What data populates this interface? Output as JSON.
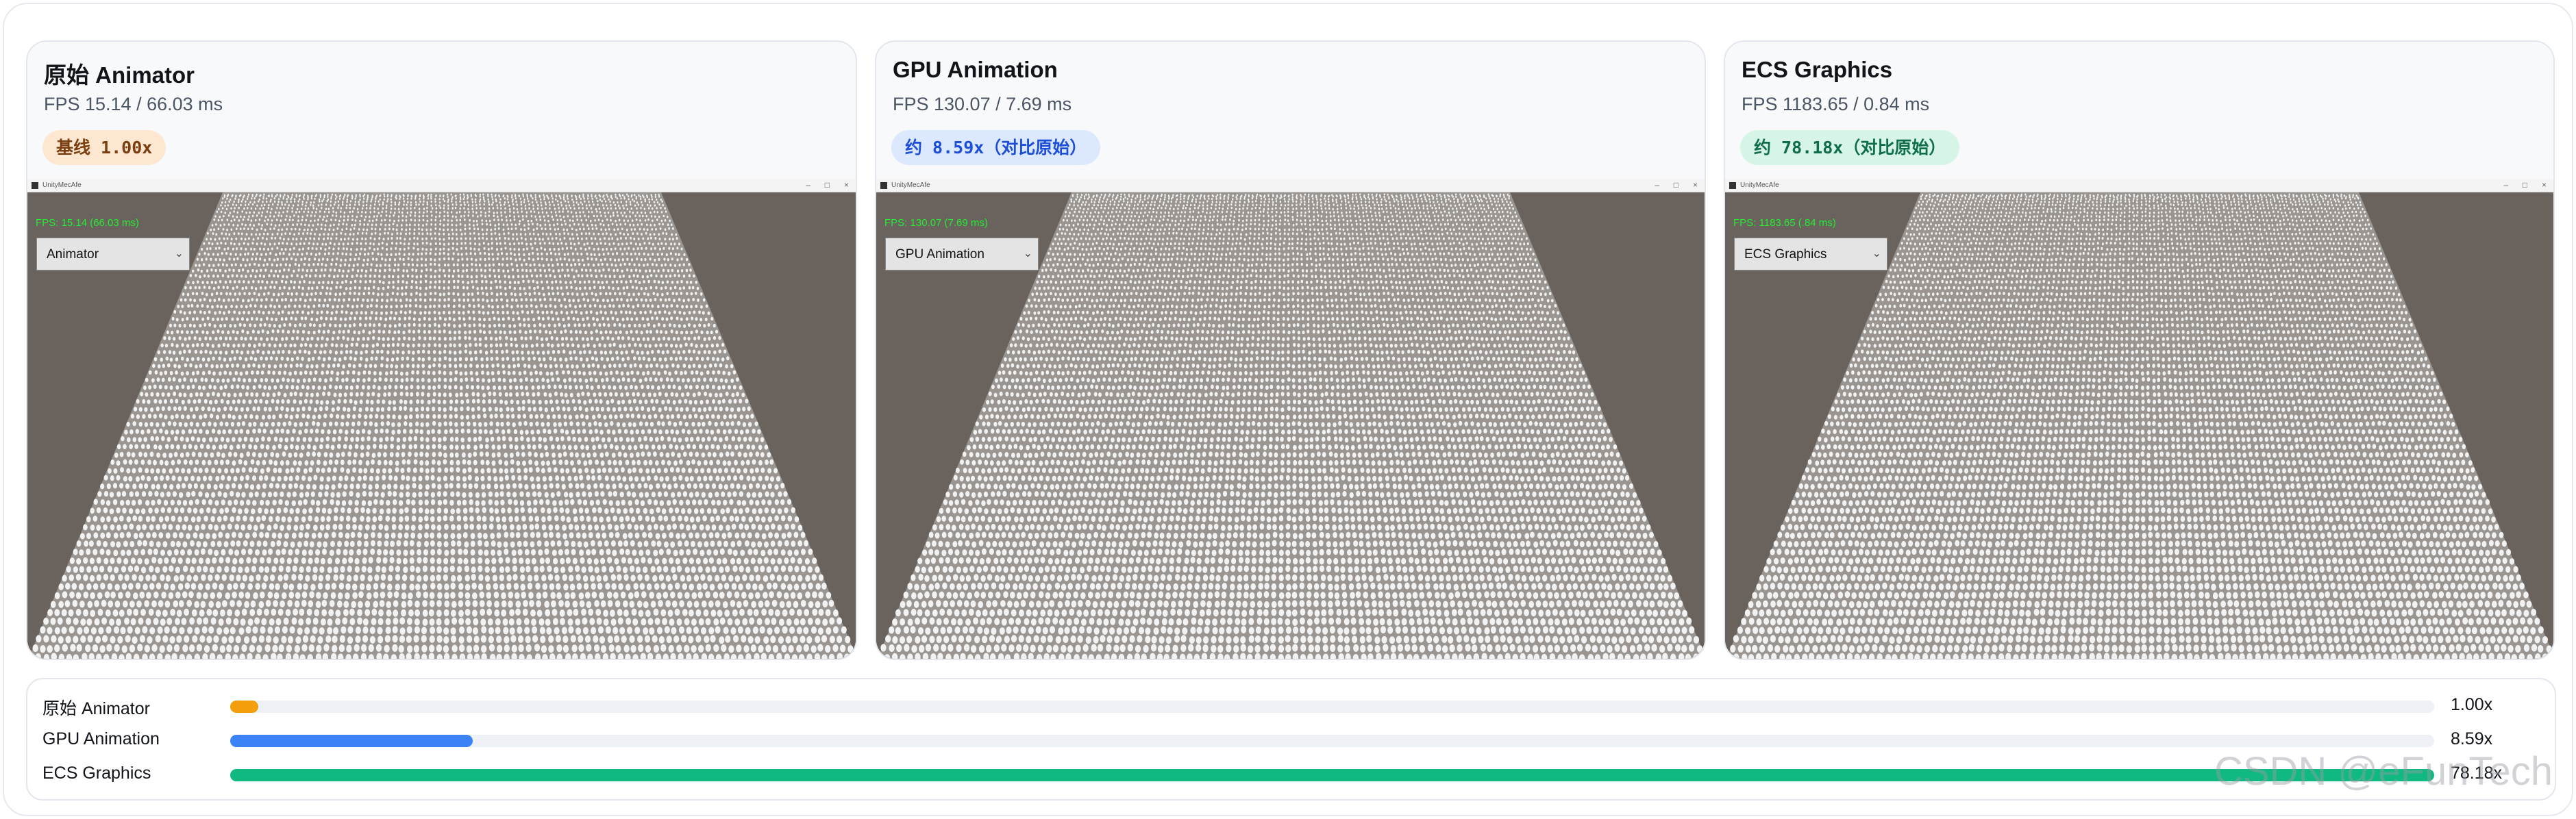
{
  "cards": [
    {
      "title": "原始 Animator",
      "stats": "FPS 15.14 / 66.03 ms",
      "badge": "基线 1.00x",
      "badge_style": "base",
      "window_title": "UnityMecAfe",
      "fps_overlay": "FPS: 15.14 (66.03 ms)",
      "dropdown_value": "Animator"
    },
    {
      "title": "GPU Animation",
      "stats": "FPS 130.07 / 7.69 ms",
      "badge": "约 8.59x（对比原始）",
      "badge_style": "gpu",
      "window_title": "UnityMecAfe",
      "fps_overlay": "FPS: 130.07 (7.69 ms)",
      "dropdown_value": "GPU Animation"
    },
    {
      "title": "ECS Graphics",
      "stats": "FPS 1183.65 / 0.84 ms",
      "badge": "约 78.18x（对比原始）",
      "badge_style": "ecs",
      "window_title": "UnityMecAfe",
      "fps_overlay": "FPS: 1183.65 (.84 ms)",
      "dropdown_value": "ECS Graphics"
    }
  ],
  "comparison": [
    {
      "label": "原始 Animator",
      "value_text": "1.00x",
      "speedup": 1.0,
      "color": "#f59e0b"
    },
    {
      "label": "GPU Animation",
      "value_text": "8.59x",
      "speedup": 8.59,
      "color": "#3b82f6"
    },
    {
      "label": "ECS Graphics",
      "value_text": "78.18x",
      "speedup": 78.18,
      "color": "#10b981"
    }
  ],
  "max_speedup": 78.18,
  "watermark": "CSDN @eFunTech",
  "colors": {
    "scene_bg": "#6a625c",
    "crowd": "#f2f2f2",
    "fps_overlay": "#22ee33"
  }
}
